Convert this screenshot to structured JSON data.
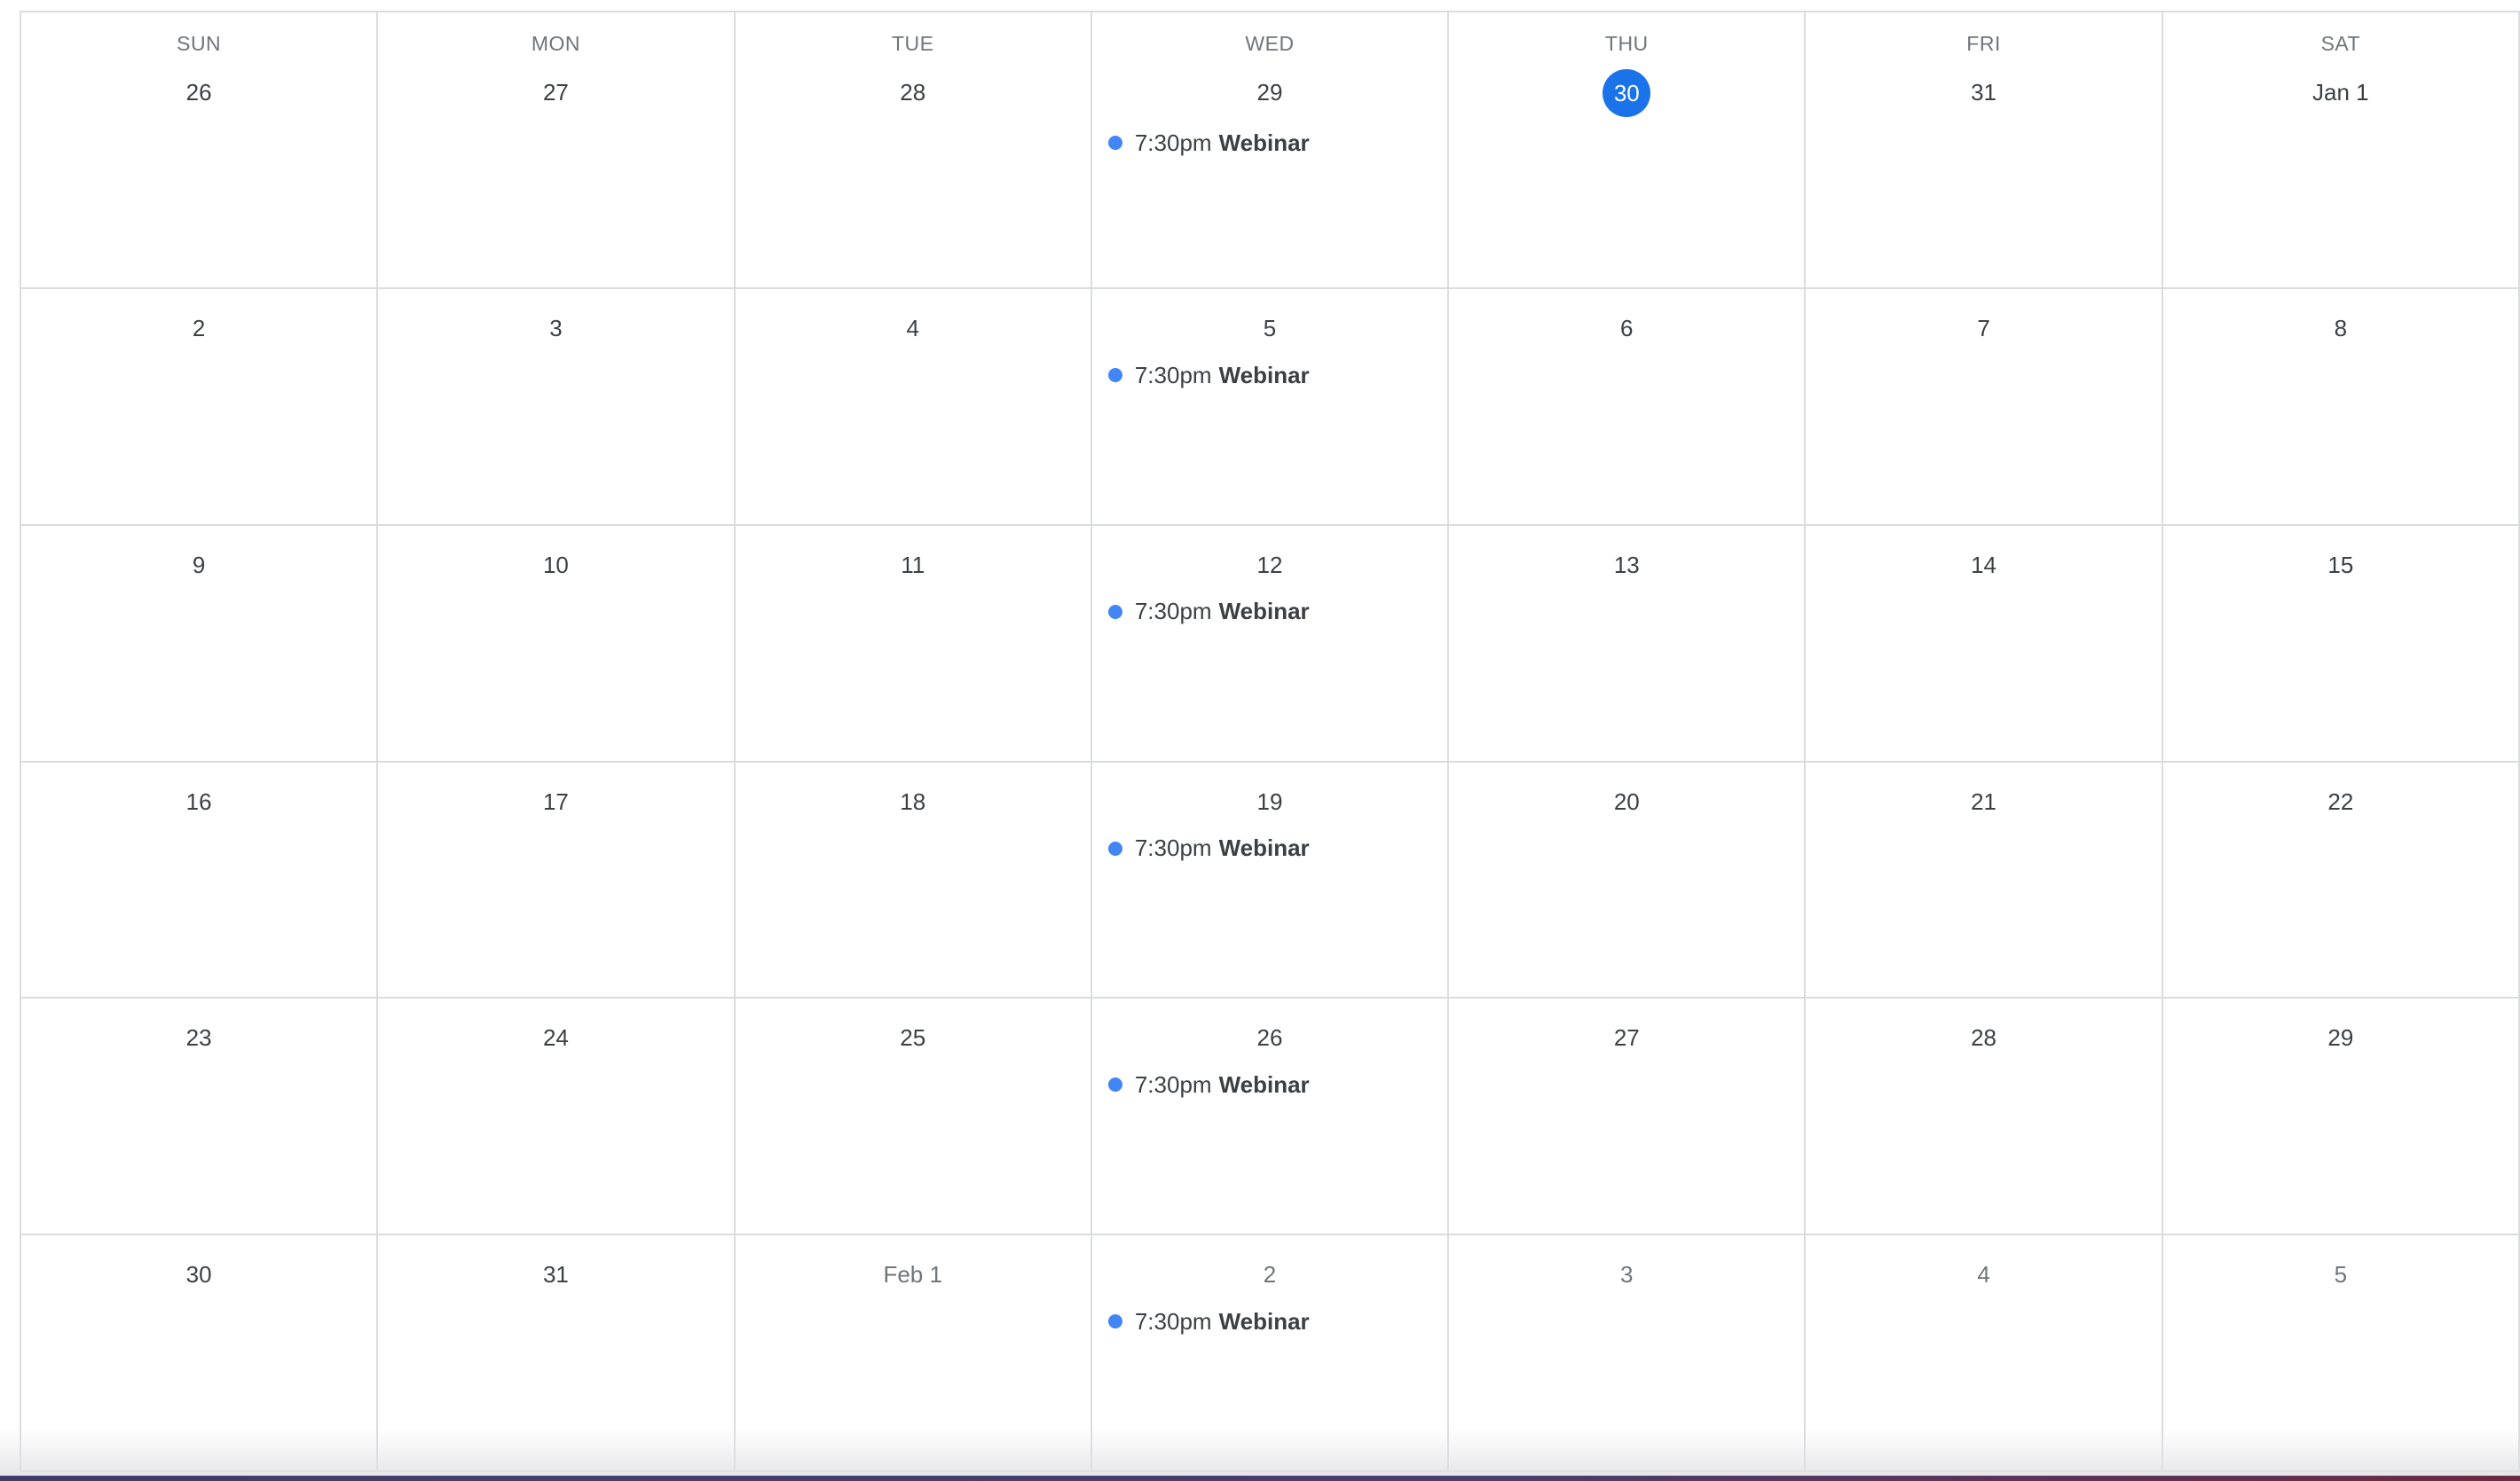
{
  "calendar": {
    "weekdays": [
      "SUN",
      "MON",
      "TUE",
      "WED",
      "THU",
      "FRI",
      "SAT"
    ],
    "weeks": [
      [
        {
          "label": "26",
          "event": null
        },
        {
          "label": "27",
          "event": null
        },
        {
          "label": "28",
          "event": null
        },
        {
          "label": "29",
          "event": {
            "time": "7:30pm",
            "title": "Webinar"
          }
        },
        {
          "label": "30",
          "today": true,
          "event": null
        },
        {
          "label": "31",
          "event": null
        },
        {
          "label": "Jan 1",
          "event": null
        }
      ],
      [
        {
          "label": "2",
          "event": null
        },
        {
          "label": "3",
          "event": null
        },
        {
          "label": "4",
          "event": null
        },
        {
          "label": "5",
          "event": {
            "time": "7:30pm",
            "title": "Webinar"
          }
        },
        {
          "label": "6",
          "event": null
        },
        {
          "label": "7",
          "event": null
        },
        {
          "label": "8",
          "event": null
        }
      ],
      [
        {
          "label": "9",
          "event": null
        },
        {
          "label": "10",
          "event": null
        },
        {
          "label": "11",
          "event": null
        },
        {
          "label": "12",
          "event": {
            "time": "7:30pm",
            "title": "Webinar"
          }
        },
        {
          "label": "13",
          "event": null
        },
        {
          "label": "14",
          "event": null
        },
        {
          "label": "15",
          "event": null
        }
      ],
      [
        {
          "label": "16",
          "event": null
        },
        {
          "label": "17",
          "event": null
        },
        {
          "label": "18",
          "event": null
        },
        {
          "label": "19",
          "event": {
            "time": "7:30pm",
            "title": "Webinar"
          }
        },
        {
          "label": "20",
          "event": null
        },
        {
          "label": "21",
          "event": null
        },
        {
          "label": "22",
          "event": null
        }
      ],
      [
        {
          "label": "23",
          "event": null
        },
        {
          "label": "24",
          "event": null
        },
        {
          "label": "25",
          "event": null
        },
        {
          "label": "26",
          "event": {
            "time": "7:30pm",
            "title": "Webinar"
          }
        },
        {
          "label": "27",
          "event": null
        },
        {
          "label": "28",
          "event": null
        },
        {
          "label": "29",
          "event": null
        }
      ],
      [
        {
          "label": "30",
          "event": null
        },
        {
          "label": "31",
          "event": null
        },
        {
          "label": "Feb 1",
          "other_month": true,
          "event": null
        },
        {
          "label": "2",
          "other_month": true,
          "event": {
            "time": "7:30pm",
            "title": "Webinar"
          }
        },
        {
          "label": "3",
          "other_month": true,
          "event": null
        },
        {
          "label": "4",
          "other_month": true,
          "event": null
        },
        {
          "label": "5",
          "other_month": true,
          "event": null
        }
      ]
    ]
  },
  "colors": {
    "today_circle": "#1a73e8",
    "event_dot": "#4285f4",
    "grid_line": "#dadce0"
  }
}
